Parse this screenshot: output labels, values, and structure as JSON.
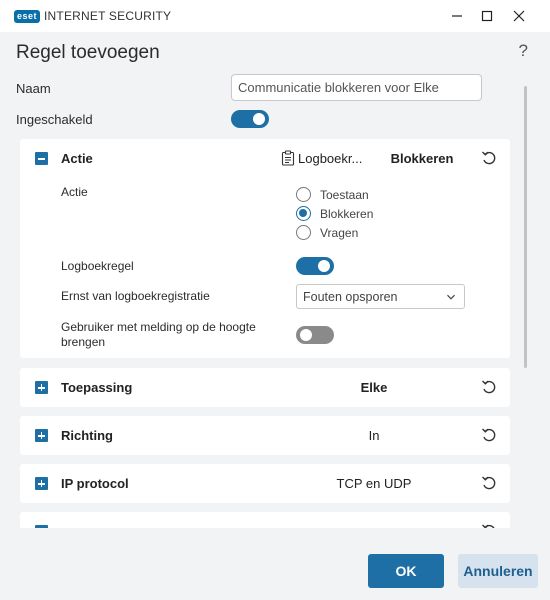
{
  "window": {
    "brand": "eset",
    "product": "INTERNET SECURITY",
    "controls": [
      "minimize-icon",
      "maximize-icon",
      "close-icon"
    ]
  },
  "header": {
    "title": "Regel toevoegen",
    "help": "?"
  },
  "form": {
    "name_label": "Naam",
    "name_value": "Communicatie blokkeren voor Elke",
    "enabled_label": "Ingeschakeld",
    "enabled": true
  },
  "sections": {
    "actie": {
      "title": "Actie",
      "log_chip": "Logboekr...",
      "value": "Blokkeren",
      "expanded": true,
      "action_label": "Actie",
      "options": [
        "Toestaan",
        "Blokkeren",
        "Vragen"
      ],
      "selected_option": "Blokkeren",
      "log_rule_label": "Logboekregel",
      "log_rule_enabled": true,
      "severity_label": "Ernst van logboekregistratie",
      "severity_value": "Fouten opsporen",
      "notify_label_1": "Gebruiker met melding op de hoogte",
      "notify_label_2": "brengen",
      "notify_enabled": false
    },
    "toepassing": {
      "title": "Toepassing",
      "value": "Elke"
    },
    "richting": {
      "title": "Richting",
      "value": "In"
    },
    "ip_protocol": {
      "title": "IP protocol",
      "value": "TCP en UDP"
    }
  },
  "footer": {
    "ok_label": "OK",
    "cancel_label": "Annuleren"
  },
  "colors": {
    "accent": "#1d6fa5",
    "background": "#f2f3f4",
    "toggle_off": "#8a8a8a"
  }
}
